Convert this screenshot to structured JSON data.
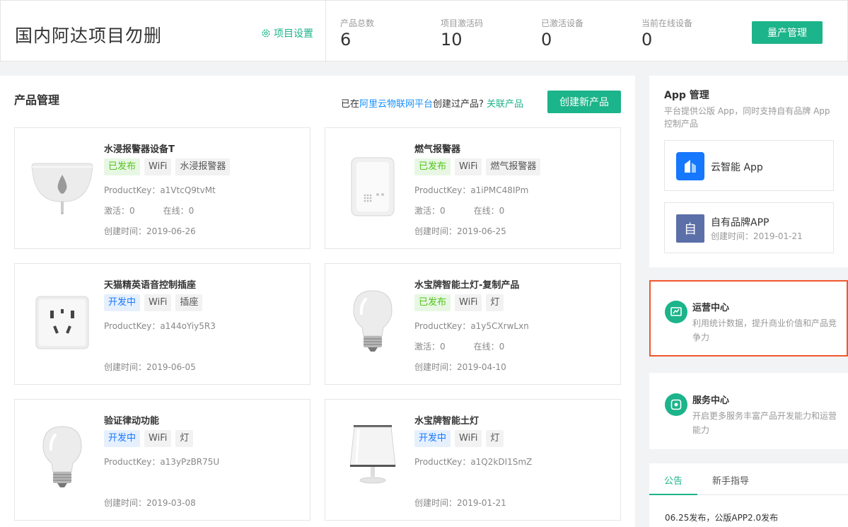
{
  "header": {
    "title": "国内阿达项目勿删",
    "settings_label": "项目设置",
    "stats": [
      {
        "label": "产品总数",
        "value": "6"
      },
      {
        "label": "项目激活码",
        "value": "10"
      },
      {
        "label": "已激活设备",
        "value": "0"
      },
      {
        "label": "当前在线设备",
        "value": "0"
      }
    ],
    "mass_button": "量产管理"
  },
  "products": {
    "title": "产品管理",
    "created_prefix": "已在",
    "platform_link": "阿里云物联网平台",
    "created_suffix": "创建过产品?",
    "link_label": "关联产品",
    "create_button": "创建新产品",
    "items": [
      {
        "name": "水浸报警器设备T",
        "status": "已发布",
        "net": "WiFi",
        "category": "水浸报警器",
        "key": "ProductKey：a1VtcQ9tvMt",
        "active": "激活：0",
        "online": "在线：0",
        "time": "创建时间：2019-06-26",
        "icon": "water-sensor-icon"
      },
      {
        "name": "燃气报警器",
        "status": "已发布",
        "net": "WiFi",
        "category": "燃气报警器",
        "key": "ProductKey：a1iPMC48IPm",
        "active": "激活：0",
        "online": "在线：0",
        "time": "创建时间：2019-06-25",
        "icon": "gas-alarm-icon"
      },
      {
        "name": "天猫精英语音控制插座",
        "status": "开发中",
        "net": "WiFi",
        "category": "插座",
        "key": "ProductKey：a144oYiy5R3",
        "active": "",
        "online": "",
        "time": "创建时间：2019-06-05",
        "icon": "socket-icon"
      },
      {
        "name": "水宝牌智能土灯-复制产品",
        "status": "已发布",
        "net": "WiFi",
        "category": "灯",
        "key": "ProductKey：a1y5CXrwLxn",
        "active": "激活：0",
        "online": "在线：0",
        "time": "创建时间：2019-04-10",
        "icon": "bulb-icon"
      },
      {
        "name": "验证律动功能",
        "status": "开发中",
        "net": "WiFi",
        "category": "灯",
        "key": "ProductKey：a13yPzBR75U",
        "active": "",
        "online": "",
        "time": "创建时间：2019-03-08",
        "icon": "bulb-icon"
      },
      {
        "name": "水宝牌智能土灯",
        "status": "开发中",
        "net": "WiFi",
        "category": "灯",
        "key": "ProductKey：a1Q2kDI1SmZ",
        "active": "",
        "online": "",
        "time": "创建时间：2019-01-21",
        "icon": "lamp-icon"
      }
    ]
  },
  "app_mgmt": {
    "title": "App 管理",
    "desc": "平台提供公版 App，同时支持自有品牌 App 控制产品",
    "cloud_app": "云智能 App",
    "own_app": "自有品牌APP",
    "own_app_icon_text": "自",
    "own_app_time": "创建时间：2019-01-21"
  },
  "ops_center": {
    "title": "运营中心",
    "desc": "利用统计数据，提升商业价值和产品竞争力"
  },
  "svc_center": {
    "title": "服务中心",
    "desc": "开启更多服务丰富产品开发能力和运营能力"
  },
  "notice": {
    "tabs": [
      "公告",
      "新手指导"
    ],
    "items": [
      "06.25发布，公版APP2.0发布"
    ]
  },
  "colors": {
    "accent": "#1cb48a",
    "highlight": "#f0582e",
    "link": "#1890ff"
  }
}
